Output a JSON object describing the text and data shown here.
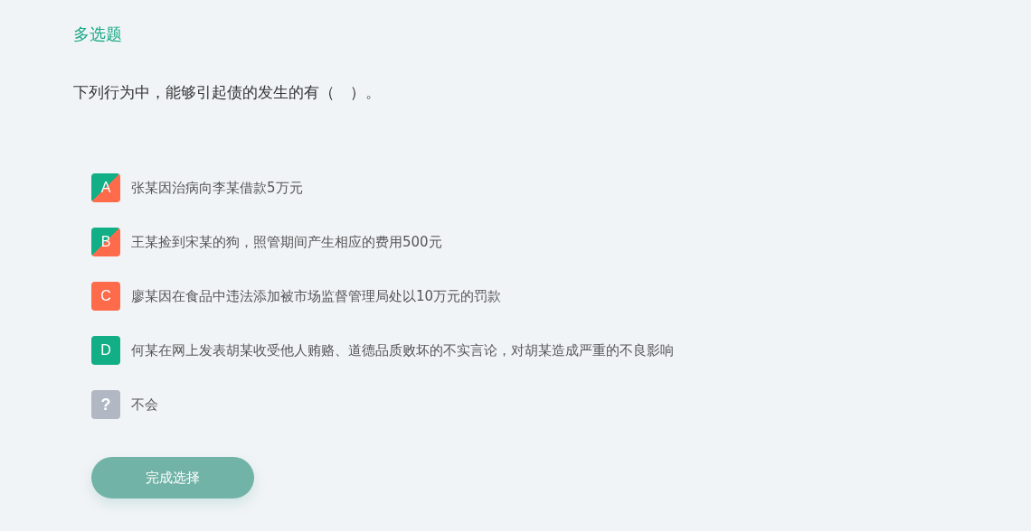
{
  "question_type": "多选题",
  "question": "下列行为中，能够引起债的发生的有（　）。",
  "options": [
    {
      "letter": "A",
      "text": "张某因治病向李某借款5万元",
      "kind": "split"
    },
    {
      "letter": "B",
      "text": "王某捡到宋某的狗，照管期间产生相应的费用500元",
      "kind": "split"
    },
    {
      "letter": "C",
      "text": "廖某因在食品中违法添加被市场监督管理局处以10万元的罚款",
      "kind": "wrong"
    },
    {
      "letter": "D",
      "text": "何某在网上发表胡某收受他人贿赂、道德品质败坏的不实言论，对胡某造成严重的不良影响",
      "kind": "right"
    },
    {
      "letter": "?",
      "text": "不会",
      "kind": "unknown"
    }
  ],
  "submit_button": "完成选择"
}
